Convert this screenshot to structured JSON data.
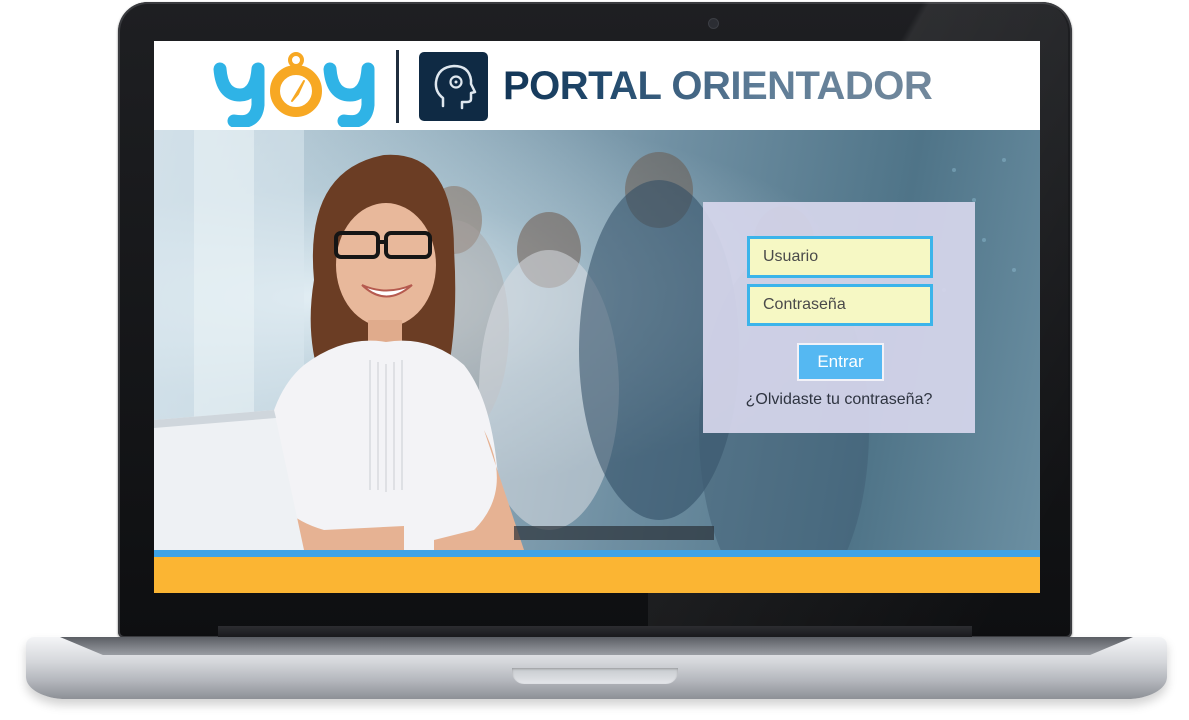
{
  "header": {
    "brand_logo": "yoy",
    "portal_title": "PORTAL ORIENTADOR",
    "portal_icon": "head-profile-icon"
  },
  "login": {
    "username_placeholder": "Usuario",
    "password_placeholder": "Contraseña",
    "submit_label": "Entrar",
    "forgot_password": "¿Olvidaste tu contraseña?"
  },
  "colors": {
    "accent_blue": "#3fa3e6",
    "footer_orange": "#fbb533",
    "input_bg": "#f6f8c4",
    "input_border": "#3bb4ea",
    "button_bg": "#55b8f2",
    "title_navy": "#123556"
  }
}
